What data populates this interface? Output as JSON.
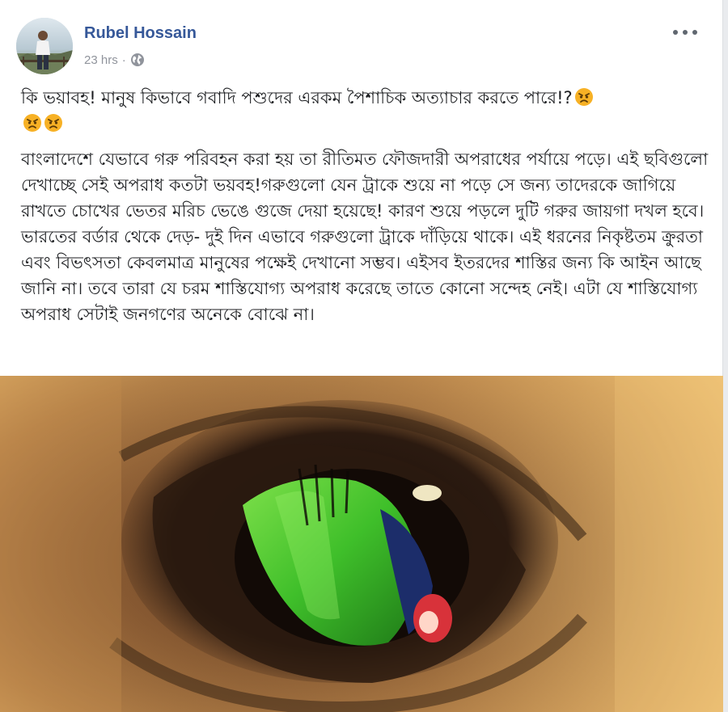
{
  "post": {
    "author": "Rubel Hossain",
    "time": "23 hrs",
    "separator": "·",
    "privacy_icon": "globe-icon",
    "more_icon": "more-options-icon",
    "line1_text": "কি ভয়াবহ! মানুষ কিভাবে গবাদি পশুদের এরকম পৈশাচিক অত্যাচার করতে পারে!?",
    "line1_emoji": "angry-face-emoji",
    "body": "বাংলাদেশে যেভাবে গরু পরিবহন করা হয় তা রীতিমত ফৌজদারী অপরাধের পর্যায়ে পড়ে। এই ছবিগুলো দেখাচ্ছে সেই অপরাধ কতটা ভয়বহ!গরুগুলো যেন ট্রাকে শুয়ে না পড়ে সে জন্য তাদেরকে জাগিয়ে রাখতে চোখের ভেতর মরিচ ভেঙে গুজে দেয়া হয়েছে! কারণ শুয়ে পড়লে দুটি গরুর জায়গা দখল হবে।ভারতের বর্ডার থেকে দেড়- দুই দিন এভাবে গরুগুলো ট্রাকে দাঁড়িয়ে থাকে। এই ধরনের নিকৃষ্টতম ক্রুরতা এবং বিভৎসতা কেবলমাত্র মানুষের পক্ষেই দেখানো সম্ভব। এইসব ইতরদের শাস্তির জন্য কি আইন আছে জানি না। তবে তারা যে চরম শাস্তিযোগ্য অপরাধ করেছে তাতে কোনো সন্দেহ নেই। এটা যে শাস্তিযোগ্য অপরাধ সেটাই জনগণের অনেকে বোঝে না।",
    "photo_alt": "close-up of cow eye"
  },
  "colors": {
    "author": "#365899",
    "meta": "#90949c",
    "text": "#1c1e21",
    "emoji": "#f7b125"
  }
}
